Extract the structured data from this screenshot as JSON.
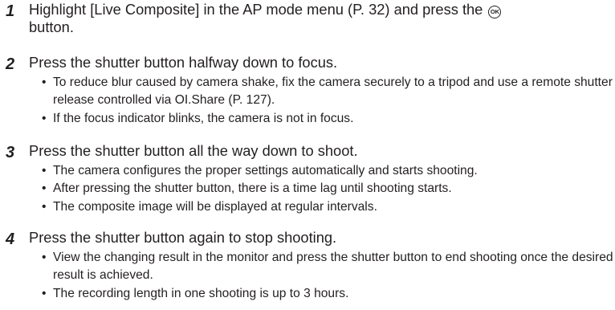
{
  "steps": [
    {
      "number": "1",
      "text_before": "Highlight [Live Composite] in the AP mode menu (P. 32) and press the",
      "icon": "ok-button-icon",
      "icon_text": "OK",
      "text_after": "button.",
      "bullets": []
    },
    {
      "number": "2",
      "text": "Press the shutter button halfway down to focus.",
      "bullets": [
        "To reduce blur caused by camera shake, fix the camera securely to a tripod and use a remote shutter release controlled via OI.Share (P. 127).",
        "If the focus indicator blinks, the camera is not in focus."
      ]
    },
    {
      "number": "3",
      "text": "Press the shutter button all the way down to shoot.",
      "bullets": [
        "The camera configures the proper settings automatically and starts shooting.",
        "After pressing the shutter button, there is a time lag until shooting starts.",
        "The composite image will be displayed at regular intervals."
      ]
    },
    {
      "number": "4",
      "text": "Press the shutter button again to stop shooting.",
      "bullets": [
        "View the changing result in the monitor and press the shutter button to end shooting once the desired result is achieved.",
        "The recording length in one shooting is up to 3 hours."
      ]
    }
  ],
  "bullet_symbol": "•"
}
